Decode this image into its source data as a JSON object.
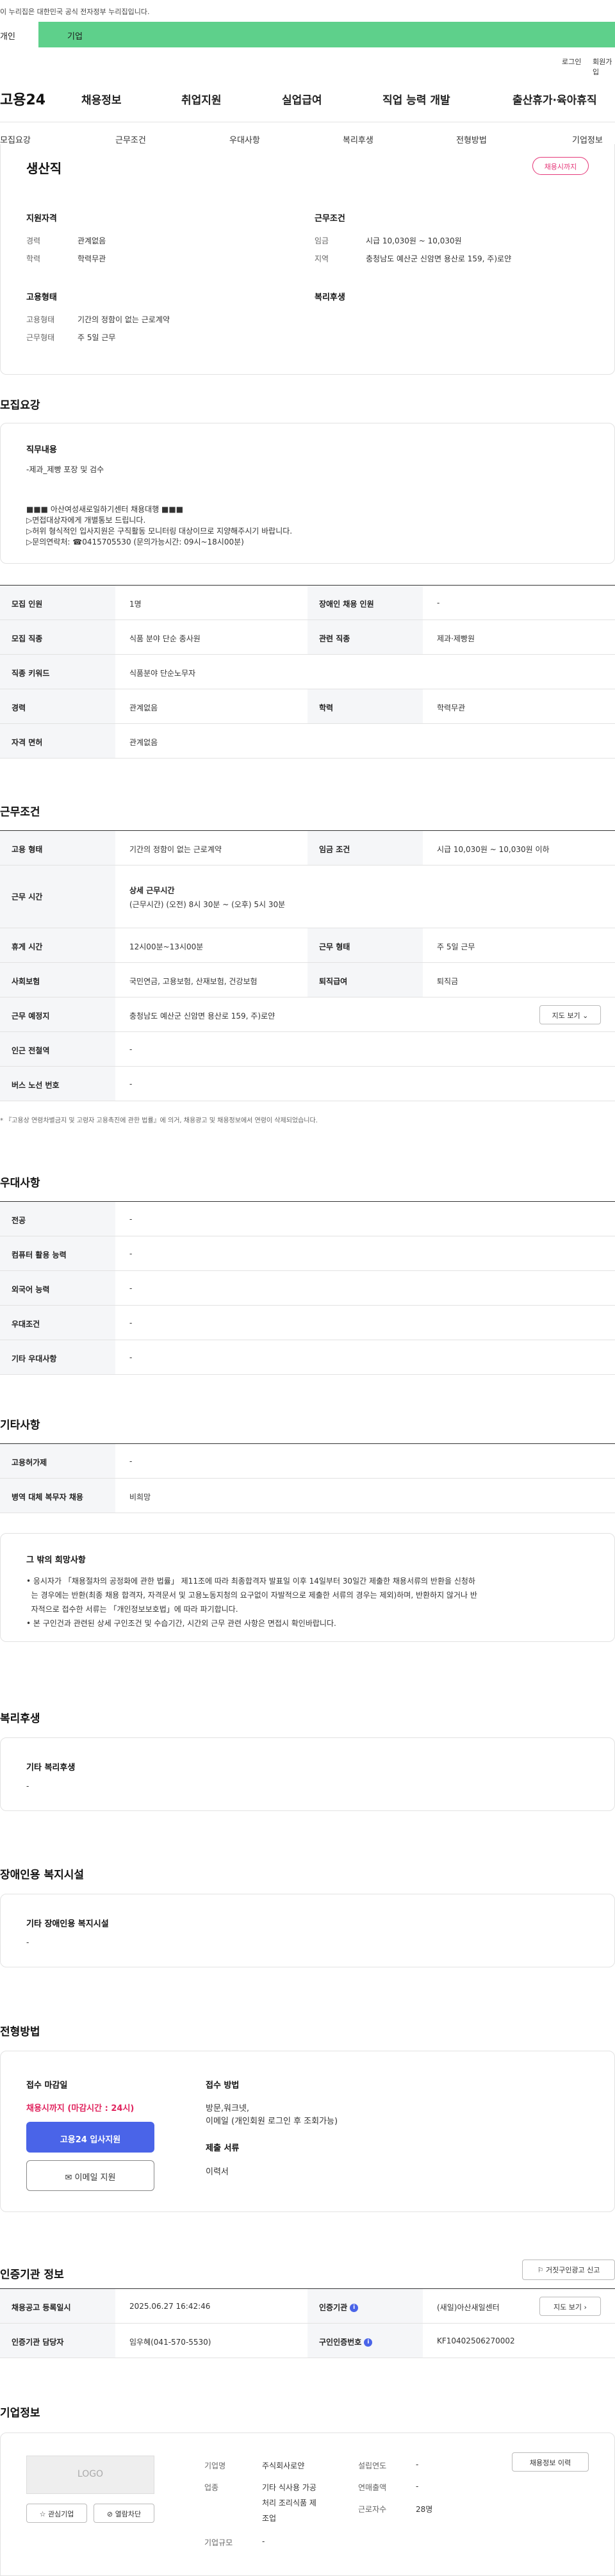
{
  "gov_bar": {
    "text": "이 누리집은 대한민국 공식 전자정부 누리집입니다."
  },
  "top_tabs": {
    "personal": "개인",
    "corp": "기업"
  },
  "util": {
    "login": "로그인",
    "join": "회원가입"
  },
  "header": {
    "logo": "고용24",
    "gnb": [
      "채용정보",
      "취업지원",
      "실업급여",
      "직업 능력 개발",
      "출산휴가·육아휴직"
    ]
  },
  "tabs": [
    "모집요강",
    "근무조건",
    "우대사항",
    "복리후생",
    "전형방법",
    "기업정보"
  ],
  "summary": {
    "title": "생산직",
    "badge": "채용시까지",
    "qualification": {
      "heading": "지원자격",
      "career_label": "경력",
      "career": "관계없음",
      "edu_label": "학력",
      "edu": "학력무관"
    },
    "conditions": {
      "heading": "근무조건",
      "wage_label": "임금",
      "wage": "시급 10,030원 ~ 10,030원",
      "area_label": "지역",
      "area": "충청남도 예산군 신암면 용산로 159, 주)로얀"
    },
    "employment": {
      "heading": "고용형태",
      "type_label": "고용형태",
      "type": "기간의 정함이 없는 근로계약",
      "form_label": "근무형태",
      "form": "주 5일 근무"
    },
    "welfare": {
      "heading": "복리후생"
    }
  },
  "recruit": {
    "heading": "모집요강",
    "duty_title": "직무내용",
    "duty_lines": [
      "-제과_제빵 포장 및 검수",
      "",
      "",
      "■■■ 아산여성새로일하기센터 채용대행 ■■■",
      "▷면접대상자에게 개별통보 드립니다.",
      "▷허위 형식적인 입사지원은 구직활동 모니터링 대상이므로 지양해주시기 바랍니다.",
      "▷문의연락처:  ☎0415705530 (문의가능시간: 09시~18시00분)"
    ],
    "rows": [
      {
        "th1": "모집 인원",
        "td1": "1명",
        "th2": "장애인 채용 인원",
        "td2": "-"
      },
      {
        "th1": "모집 직종",
        "td1": "식품 분야 단순 종사원",
        "th2": "관련 직종",
        "td2": "제과·제빵원"
      },
      {
        "th1": "직종 키워드",
        "td1": "식품분야 단순노무자"
      },
      {
        "th1": "경력",
        "td1": "관계없음",
        "th2": "학력",
        "td2": "학력무관"
      },
      {
        "th1": "자격 면허",
        "td1": "관계없음"
      }
    ]
  },
  "work": {
    "heading": "근무조건",
    "r1": {
      "th1": "고용 형태",
      "td1": "기간의 정함이 없는 근로계약",
      "th2": "임금 조건",
      "td2": "시급 10,030원 ~ 10,030원 이하"
    },
    "r2": {
      "th1": "근무 시간",
      "title": "상세 근무시간",
      "detail": "(근무시간) (오전) 8시 30분 ~ (오후) 5시 30분"
    },
    "r3": {
      "th1": "휴게 시간",
      "td1": "12시00분~13시00분",
      "th2": "근무 형태",
      "td2": "주 5일 근무"
    },
    "r4": {
      "th1": "사회보험",
      "td1": "국민연금, 고용보험, 산재보험, 건강보험",
      "th2": "퇴직급여",
      "td2": "퇴직금"
    },
    "r5": {
      "th1": "근무 예정지",
      "td1": "충청남도 예산군 신암면 용산로 159, 주)로얀",
      "map_btn": "지도 보기"
    },
    "r6": {
      "th1": "인근 전철역",
      "td1": "-"
    },
    "r7": {
      "th1": "버스 노선 번호",
      "td1": "-"
    },
    "notice": "* 『고용상 연령차별금지 및 고령자 고용촉진에 관한 법률』에 의거, 채용광고 및 채용정보에서 연령이 삭제되었습니다."
  },
  "pref": {
    "heading": "우대사항",
    "rows": [
      {
        "th": "전공",
        "td": "-"
      },
      {
        "th": "컴퓨터 활용 능력",
        "td": "-"
      },
      {
        "th": "외국어 능력",
        "td": "-"
      },
      {
        "th": "우대조건",
        "td": "-"
      },
      {
        "th": "기타 우대사항",
        "td": "-"
      }
    ]
  },
  "etc": {
    "heading": "기타사항",
    "rows": [
      {
        "th": "고용허가제",
        "td": "-"
      },
      {
        "th": "병역 대체 복무자 채용",
        "td": "비희망"
      }
    ],
    "box_title": "그 밖의 희망사항",
    "box_lines": [
      "• 응시자가 「채용절차의 공정화에 관한 법률」 제11조에 따라 최종합격자 발표일 이후 14일부터 30일간 제출한 채용서류의 반환을 신청하",
      "  는 경우에는 반환(최종 채용 합격자, 자격문서 및 고용노동지청의 요구없이 자발적으로 제출한 서류의 경우는 제외)하며, 반환하지 않거나 반",
      "  자적으로 접수한 서류는 「개인정보보호법」에 따라 파기합니다.",
      "• 본 구인건과 관련된 상세 구인조건 및 수습기간, 시간외 근무 관련 사항은 면접시 확인바랍니다."
    ]
  },
  "welfare": {
    "heading": "복리후생",
    "box_title": "기타 복리후생",
    "box_value": "-"
  },
  "disability": {
    "heading": "장애인용 복지시설",
    "box_title": "기타 장애인용 복지시설",
    "box_value": "-"
  },
  "process": {
    "heading": "전형방법",
    "deadline_label": "접수 마감일",
    "deadline": "채용시까지 (마감시간 : 24시)",
    "apply_btn": "고용24 입사지원",
    "email_btn": "이메일 지원",
    "method_label": "접수 방법",
    "method_lines": [
      "방문,워크넷,",
      "이메일 (개인회원 로그인 후 조회가능)"
    ],
    "docs_label": "제출 서류",
    "docs": "이력서"
  },
  "agency": {
    "heading": "인증기관 정보",
    "report_btn": "거짓구인광고 신고",
    "r1": {
      "th1": "채용공고 등록일시",
      "td1": "2025.06.27 16:42:46",
      "th2": "인증기관",
      "td2": "(새일)아산새일센터",
      "map_btn": "지도 보기"
    },
    "r2": {
      "th1": "인증기관 담당자",
      "td1": "임우혜(041-570-5530)",
      "th2": "구인인증번호",
      "td2": "KF10402506270002"
    }
  },
  "company": {
    "heading": "기업정보",
    "logo": "LOGO",
    "interest_btn": "관심기업",
    "block_btn": "열람차단",
    "history_btn": "채용정보 이력",
    "name_label": "기업명",
    "name": "주식회사로얀",
    "industry_label": "업종",
    "industry_lines": [
      "기타 식사용 가공",
      "처리 조리식품 제",
      "조업"
    ],
    "scale_label": "기업규모",
    "scale": "-",
    "founded_label": "설립연도",
    "founded": "-",
    "revenue_label": "연매출액",
    "revenue": "-",
    "employees_label": "근로자수",
    "employees": "28명"
  }
}
